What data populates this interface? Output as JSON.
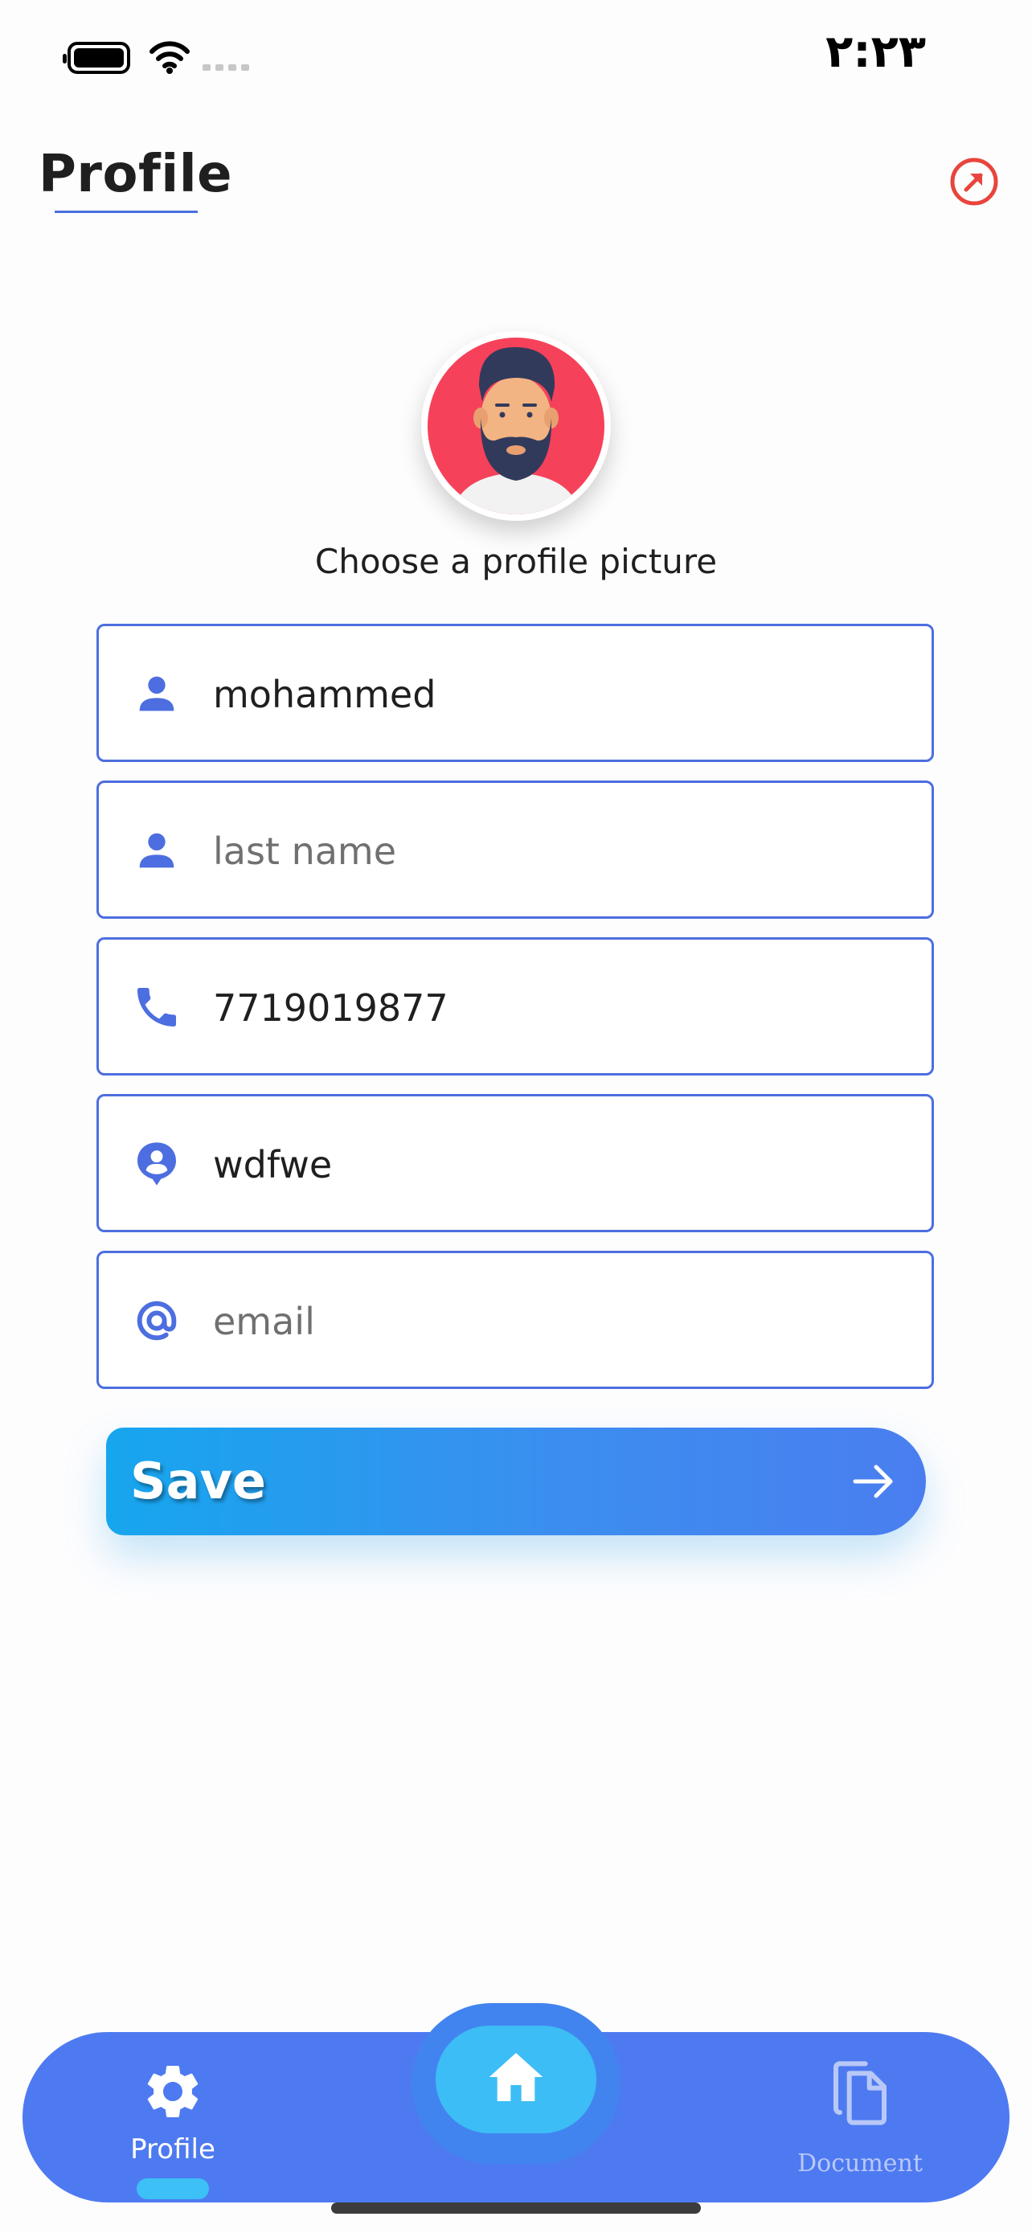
{
  "status_bar": {
    "time": "۲:۲۳",
    "icons": [
      "battery-icon",
      "wifi-icon",
      "signal-icon"
    ]
  },
  "header": {
    "title": "Profile",
    "logout_icon": "arrow-up-right-circle-icon",
    "accent_color": "#e8453c"
  },
  "profile": {
    "choose_picture_label": "Choose a profile picture"
  },
  "form": {
    "first_name": {
      "value": "mohammed",
      "placeholder": "",
      "icon": "person-icon"
    },
    "last_name": {
      "value": "",
      "placeholder": "last name",
      "icon": "person-icon"
    },
    "phone": {
      "value": "7719019877",
      "placeholder": "",
      "icon": "phone-icon"
    },
    "username": {
      "value": "wdfwe",
      "placeholder": "",
      "icon": "account-pin-icon"
    },
    "email": {
      "value": "",
      "placeholder": "email",
      "icon": "at-sign-icon"
    },
    "border_color": "#4d6ee0"
  },
  "save_button": {
    "label": "Save",
    "icon": "arrow-right-icon"
  },
  "bottom_nav": {
    "profile_label": "Profile",
    "document_label": "Document",
    "home_icon": "home-icon",
    "background_color": "#4e7af1",
    "active_color": "#3cbdf5"
  }
}
